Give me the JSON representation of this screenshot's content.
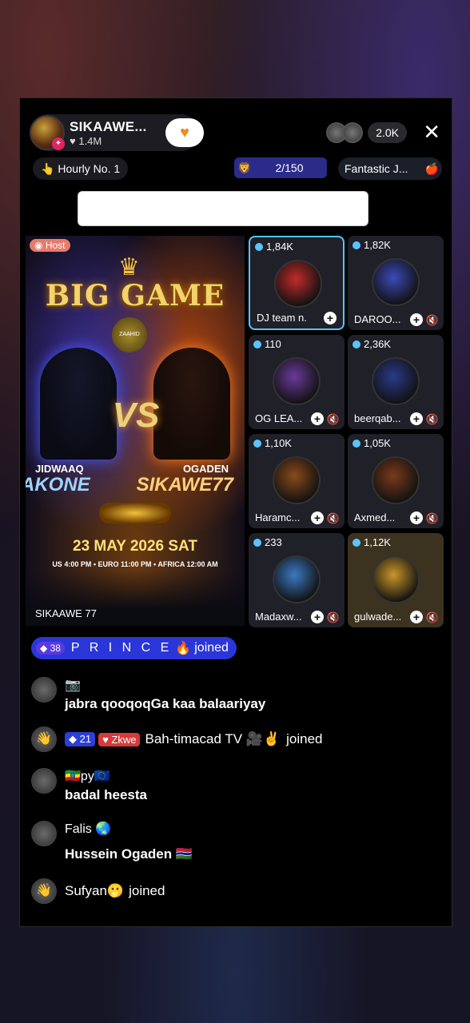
{
  "header": {
    "host_name": "SIKAAWE...",
    "host_likes": "1.4M",
    "viewer_count": "2.0K",
    "close_symbol": "✕"
  },
  "row2": {
    "hourly": "Hourly No. 1",
    "rank": "2/150",
    "fantastic": "Fantastic J..."
  },
  "poster": {
    "host_badge": "Host",
    "title": "BIG GAME",
    "emblem": "ZAAHID",
    "vs": "VS",
    "left_team_small": "JIDWAAQ",
    "left_team_big": "AKONE",
    "right_team_small": "OGADEN",
    "right_team_big": "SIKAWE77",
    "date": "23 MAY 2026 SAT",
    "times": "US 4:00 PM • EURO 11:00 PM • AFRICA 12:00 AM",
    "caption": "SIKAAWE 77"
  },
  "seats": [
    {
      "score": "1,84K",
      "name": "DJ team n...",
      "active": true,
      "gold": false,
      "mute": false,
      "color": "#c22a2a"
    },
    {
      "score": "1,82K",
      "name": "DAROO...",
      "active": false,
      "gold": false,
      "mute": true,
      "color": "#3a4ab8"
    },
    {
      "score": "110",
      "name": "OG LEA...",
      "active": false,
      "gold": false,
      "mute": true,
      "color": "#6a3a9a"
    },
    {
      "score": "2,36K",
      "name": "beerqab...",
      "active": false,
      "gold": false,
      "mute": true,
      "color": "#2a3a8a"
    },
    {
      "score": "1,10K",
      "name": "Haramc...",
      "active": false,
      "gold": false,
      "mute": true,
      "color": "#8a4a1a"
    },
    {
      "score": "1,05K",
      "name": "Axmed...",
      "active": false,
      "gold": false,
      "mute": true,
      "color": "#7a3a1a"
    },
    {
      "score": "233",
      "name": "Madaxw...",
      "active": false,
      "gold": false,
      "mute": true,
      "color": "#3a7ac2"
    },
    {
      "score": "1,12K",
      "name": "gulwade...",
      "active": false,
      "gold": true,
      "mute": true,
      "color": "#c9962a"
    }
  ],
  "joined_banner": {
    "level": "38",
    "name": "P R I N C E",
    "emoji": "🔥",
    "action": "joined"
  },
  "chat": [
    {
      "type": "msg",
      "user": "📷",
      "message": "jabra qooqoqGa kaa balaariyay"
    },
    {
      "type": "join",
      "level": "21",
      "badge": "Zkwe",
      "text": "Bah-timacad TV 🎥✌️",
      "action": "joined"
    },
    {
      "type": "msg",
      "user": "py",
      "message": "badal heesta"
    },
    {
      "type": "msg",
      "user": "Falis 🌏",
      "message": "Hussein Ogaden 🇬🇲"
    },
    {
      "type": "join",
      "text": "Sufyan🫢",
      "action": "joined"
    }
  ]
}
